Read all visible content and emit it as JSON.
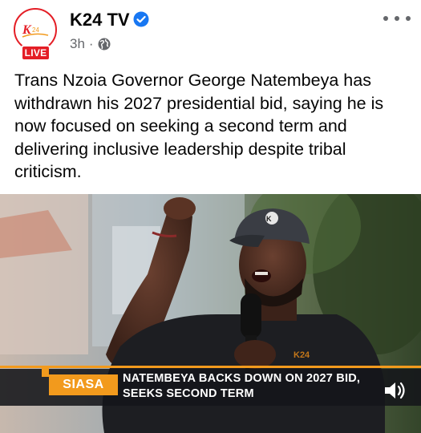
{
  "post": {
    "page_name": "K24 TV",
    "verified": true,
    "timestamp": "3h",
    "separator": "·",
    "audience_icon": "globe-icon",
    "live_badge": "LIVE",
    "logo_text": "K24",
    "more_icon": "more-options-icon",
    "text": "Trans Nzoia Governor George Natembeya has withdrawn his 2027 presidential bid, saying he is now focused on seeking a second term and delivering inclusive leadership despite tribal criticism."
  },
  "media": {
    "tag": "SIASA",
    "headline_line1": "NATEMBEYA BACKS DOWN ON 2027 BID,",
    "headline_line2": "SEEKS SECOND TERM",
    "cap_text": "K24",
    "sound_icon": "speaker-icon"
  },
  "colors": {
    "brand_red": "#e41e26",
    "accent_orange": "#f29a1d",
    "verified_blue": "#1877f2",
    "muted_text": "#65676b"
  }
}
